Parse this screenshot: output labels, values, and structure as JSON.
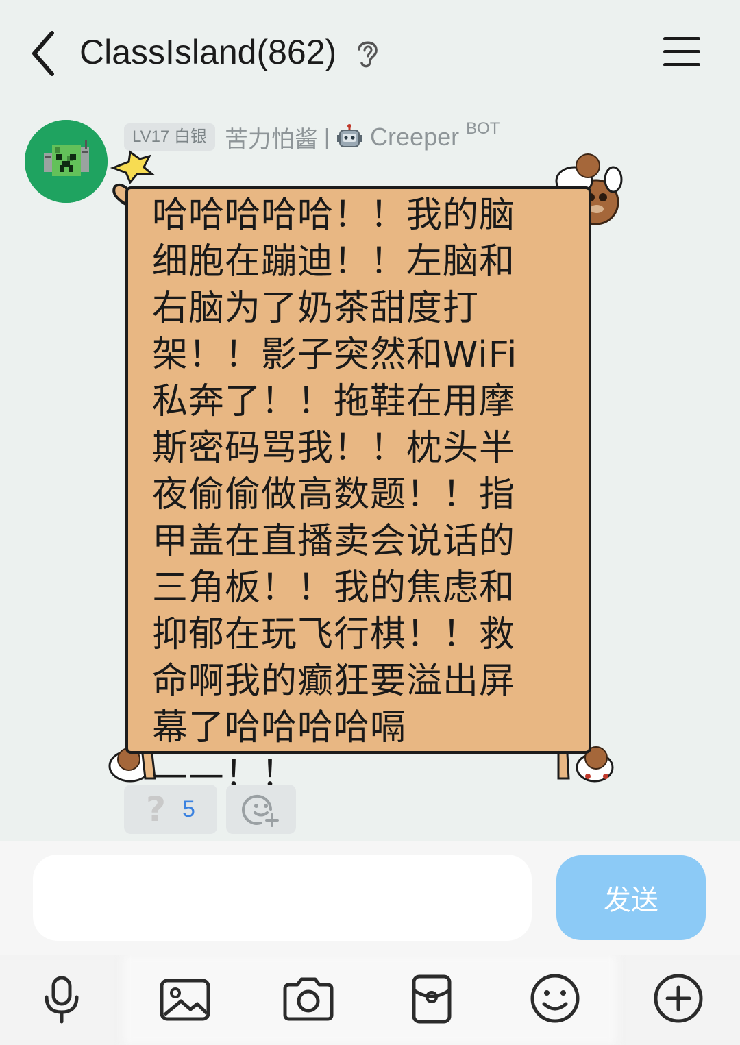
{
  "header": {
    "title": "ClassIsland(862)",
    "back_icon": "chevron-left-icon",
    "ear_icon": "ear-icon",
    "menu_icon": "hamburger-menu-icon"
  },
  "message": {
    "level_badge": "LV17 白银",
    "sender_name": "苦力怕酱",
    "separator": "|",
    "bot_emoji": "robot-icon",
    "bot_name": "Creeper",
    "bot_tag": "BOT",
    "text": "哈哈哈哈哈！！我的脑细胞在蹦迪！！左脑和右脑为了奶茶甜度打架！！影子突然和WiFi私奔了！！拖鞋在用摩斯密码骂我！！枕头半夜偷偷做高数题！！指甲盖在直播卖会说话的三角板！！我的焦虑和抑郁在玩飞行棋！！救命啊我的癫狂要溢出屏幕了哈哈哈哈嗝——！！"
  },
  "reactions": [
    {
      "emoji": "❔",
      "count": "5"
    },
    {
      "icon": "add-reaction-icon"
    }
  ],
  "composer": {
    "input_value": "",
    "send_label": "发送"
  },
  "toolbar": {
    "tools": [
      "microphone-icon",
      "image-icon",
      "camera-icon",
      "red-packet-icon",
      "emoji-icon",
      "plus-icon"
    ],
    "ghost_text": "..."
  },
  "colors": {
    "background": "#ecf1ef",
    "bubble_fill": "#e8b783",
    "bubble_border": "#1c1c1c",
    "send_button": "#8ccaf6",
    "reaction_count": "#3b82e0",
    "avatar": "#1fa360"
  }
}
